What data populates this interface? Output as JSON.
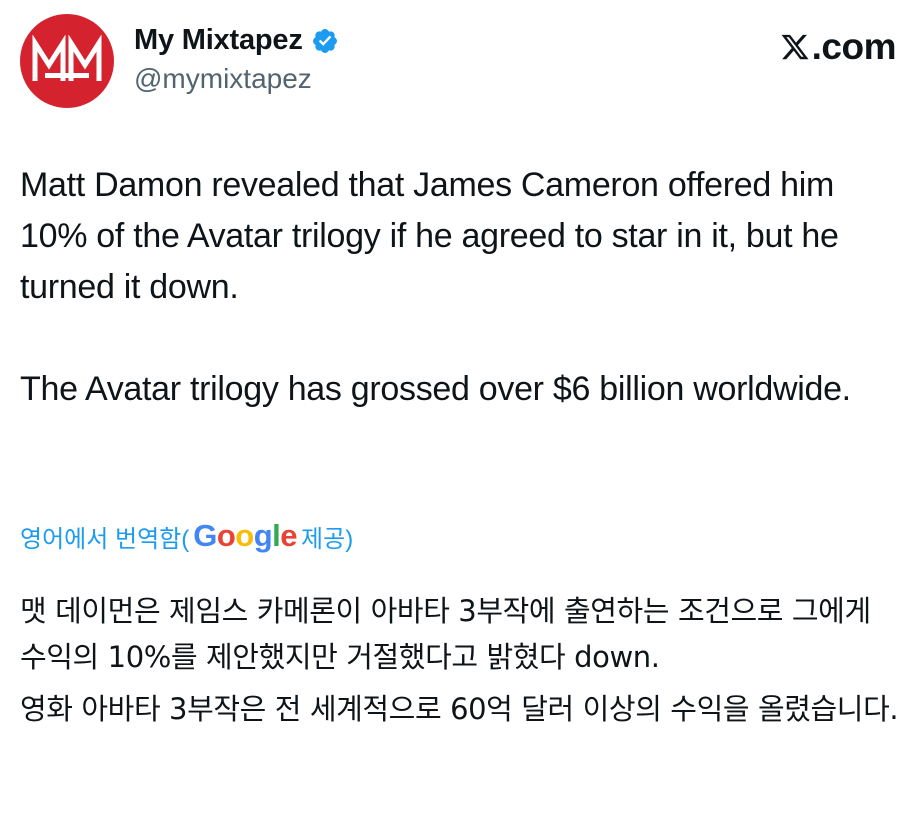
{
  "author": {
    "display_name": "My Mixtapez",
    "handle": "@mymixtapez",
    "avatar_letters": "MM",
    "verified": true
  },
  "source_label": ".com",
  "source_icon": "x-logo-icon",
  "tweet": {
    "paragraphs": [
      "Matt Damon revealed that James Cameron offered him 10% of the Avatar trilogy if he agreed to star in it, but he turned it down.",
      "The Avatar trilogy has grossed over $6 billion worldwide."
    ]
  },
  "translation": {
    "prefix": "영어에서 번역함(",
    "provider": "Google",
    "suffix": " 제공)",
    "paragraphs": [
      "맷 데이먼은 제임스 카메론이 아바타 3부작에 출연하는 조건으로 그에게 수익의 10%를 제안했지만 거절했다고 밝혔다 down.",
      "영화 아바타 3부작은 전 세계적으로 60억 달러 이상의 수익을 올렸습니다."
    ]
  },
  "colors": {
    "link": "#1d9bf0",
    "verified": "#1d9bf0",
    "avatar_bg": "#d4232f",
    "text": "#0f1419",
    "secondary_text": "#536471"
  }
}
